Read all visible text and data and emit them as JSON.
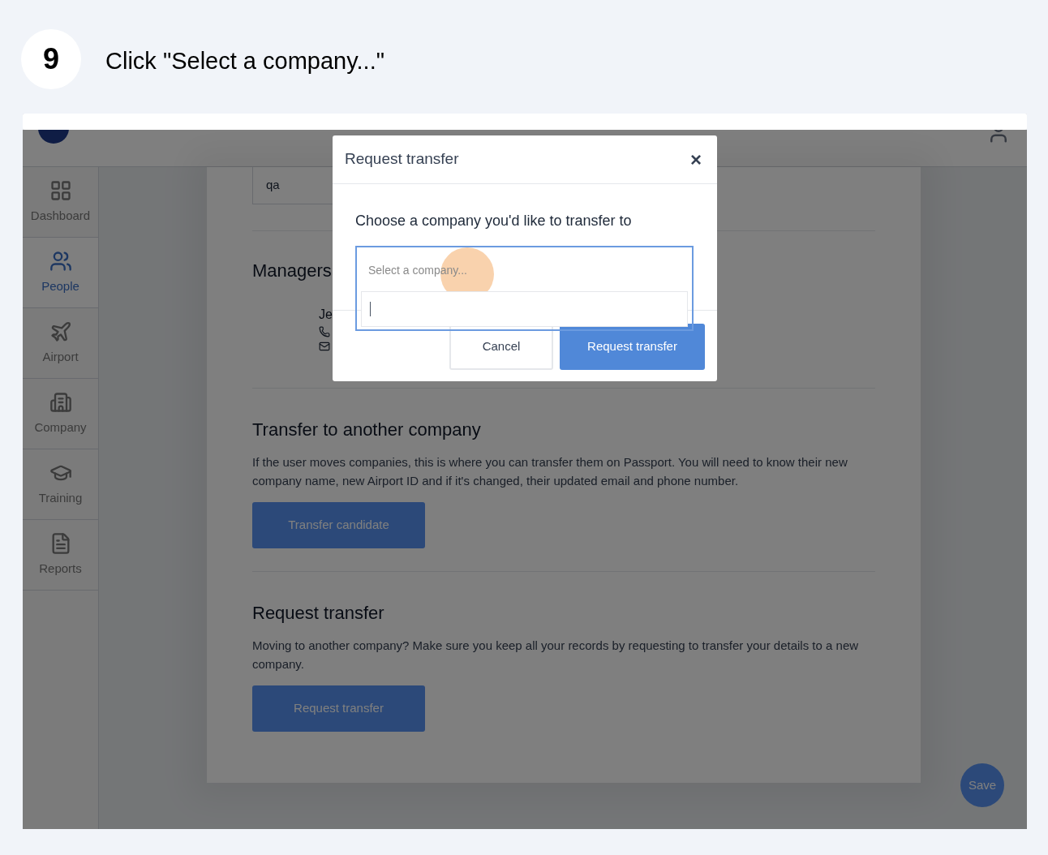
{
  "step": {
    "number": "9",
    "instruction": "Click \"Select a company...\""
  },
  "sidebar": {
    "items": [
      {
        "label": "Dashboard",
        "kind": "dashboard",
        "selected": false
      },
      {
        "label": "People",
        "kind": "people",
        "selected": true
      },
      {
        "label": "Airport",
        "kind": "airport",
        "selected": false
      },
      {
        "label": "Company",
        "kind": "company",
        "selected": false
      },
      {
        "label": "Training",
        "kind": "training",
        "selected": false
      },
      {
        "label": "Reports",
        "kind": "reports",
        "selected": false
      }
    ]
  },
  "profile": {
    "field_value": "qa",
    "managers_heading": "Managers",
    "manager_name": "Je"
  },
  "sections": [
    {
      "title": "Transfer to another company",
      "text": "If the user moves companies, this is where you can transfer them on Passport. You will need to know their new company name, new Airport ID and if it's changed, their updated email and phone number.",
      "button": "Transfer candidate"
    },
    {
      "title": "Request transfer",
      "text": "Moving to another company? Make sure you keep all your records by requesting to transfer your details to a new company.",
      "button": "Request transfer"
    }
  ],
  "save_button": "Save",
  "modal": {
    "title": "Request transfer",
    "close": "×",
    "prompt": "Choose a company you'd like to transfer to",
    "select": {
      "placeholder": "Select a company..."
    },
    "buttons": [
      {
        "label": "Cancel",
        "kind": "secondary"
      },
      {
        "label": "Request transfer",
        "kind": "primary"
      }
    ]
  }
}
